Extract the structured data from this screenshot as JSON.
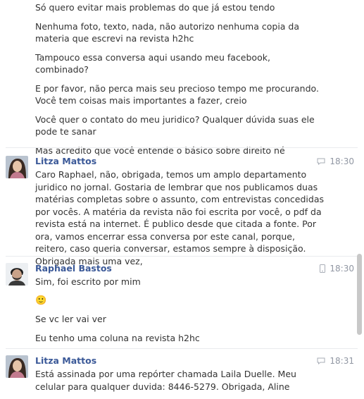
{
  "continuation_messages": [
    "Só quero evitar mais problemas do que já estou tendo",
    "Nenhuma foto, texto, nada, não autorizo nenhuma copia da materia que escrevi na revista h2hc",
    "Tampouco essa conversa aqui usando meu facebook, combinado?",
    "E por favor, não perca mais seu precioso tempo me procurando. Você tem coisas mais importantes a fazer, creio",
    "Você quer o contato do meu juridico? Qualquer dúvida suas ele pode te sanar",
    "Mas acredito que você entende o básico sobre direito né"
  ],
  "groups": [
    {
      "sender": "Litza Mattos",
      "time": "18:30",
      "source_icon": "chat-icon",
      "messages": [
        "Caro Raphael, não, obrigada, temos um amplo departamento juridico no jornal. Gostaria de lembrar que nos publicamos duas matérias completas sobre o assunto, com entrevistas concedidas por vocês. A matéria da revista não foi escrita por você, o pdf da revista está na internet. É publico desde que citada a fonte. Por ora, vamos encerrar essa conversa por este canal, porque, reitero, caso queria conversar, estamos sempre à disposição. Obrigada mais uma vez,"
      ]
    },
    {
      "sender": "Raphael Bastos",
      "time": "18:30",
      "source_icon": "mobile-icon",
      "messages": [
        "Sim, foi escrito por mim",
        "🙂",
        "Se vc ler vai ver",
        "Eu tenho uma coluna na revista h2hc"
      ]
    },
    {
      "sender": "Litza Mattos",
      "time": "18:31",
      "source_icon": "chat-icon",
      "messages": [
        "Está assinada por uma repórter chamada Laila Duelle. Meu celular para qualquer duvida: 8446-5279. Obrigada, Aline"
      ]
    }
  ],
  "colors": {
    "sender_name": "#3b5998",
    "text": "#333333",
    "meta": "#9197a3"
  }
}
